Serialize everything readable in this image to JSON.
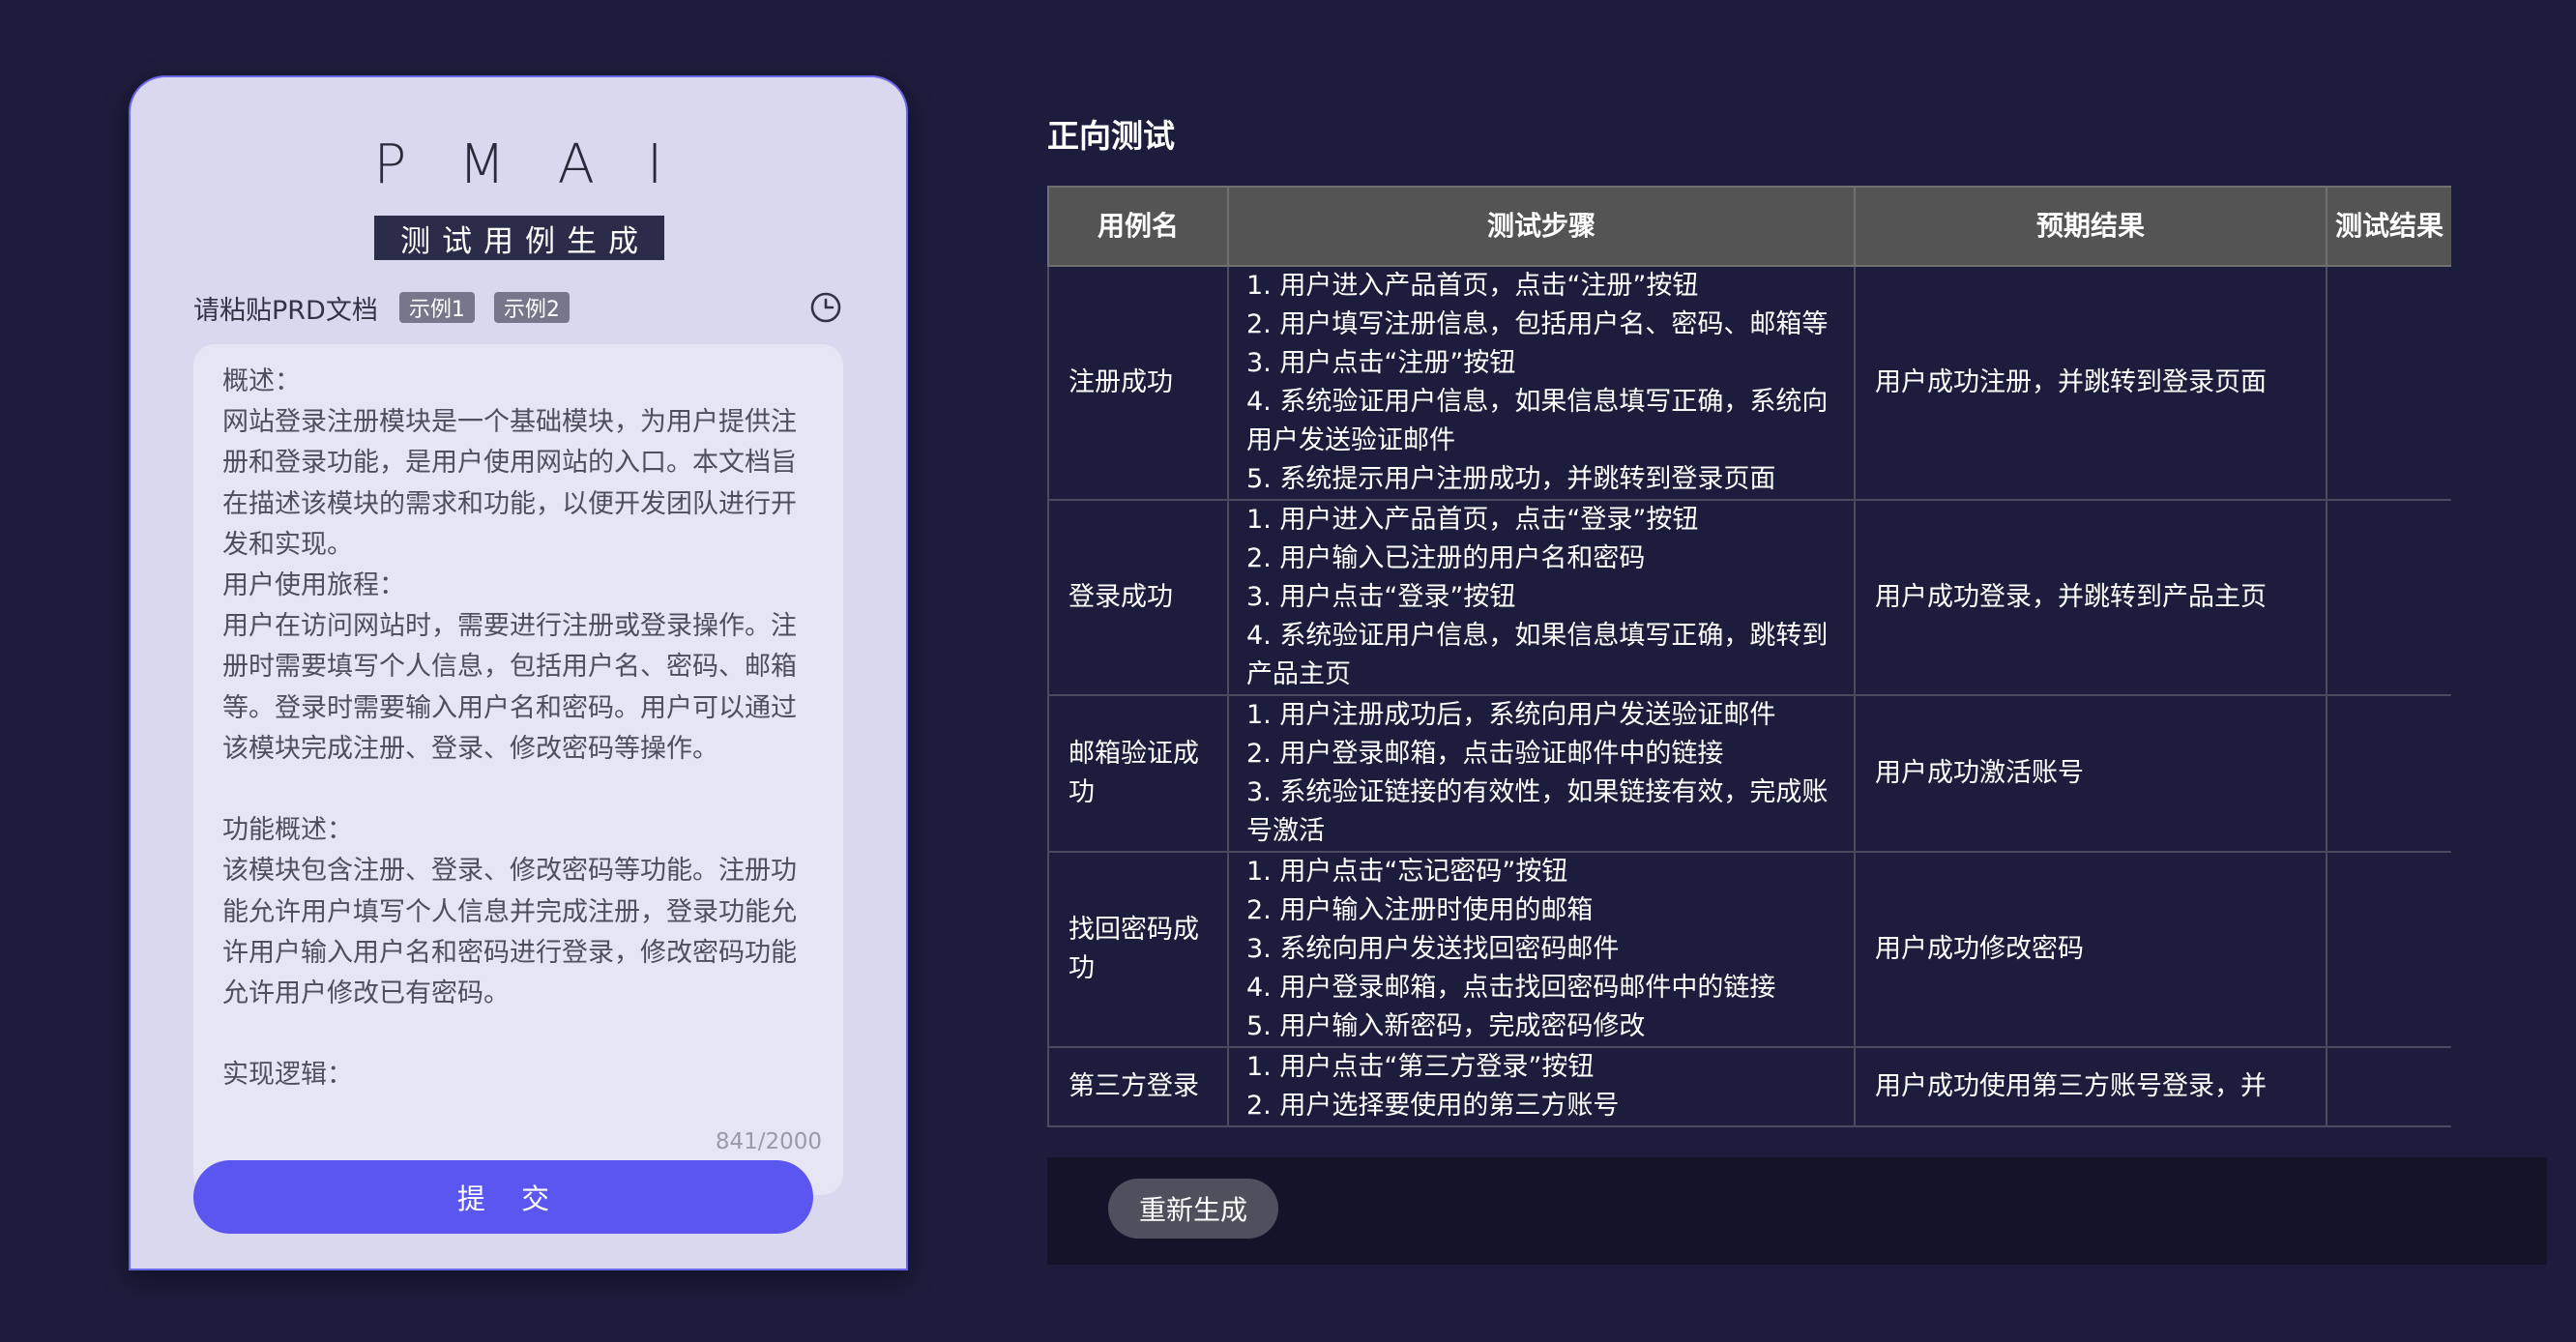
{
  "app": {
    "logo": "PMAI",
    "subtitle": "测试用例生成"
  },
  "prompt": {
    "label": "请粘贴PRD文档",
    "examples": [
      "示例1",
      "示例2"
    ],
    "history_icon": "clock-icon",
    "text": "概述：\n网站登录注册模块是一个基础模块，为用户提供注册和登录功能，是用户使用网站的入口。本文档旨在描述该模块的需求和功能，以便开发团队进行开发和实现。\n用户使用旅程：\n用户在访问网站时，需要进行注册或登录操作。注册时需要填写个人信息，包括用户名、密码、邮箱等。登录时需要输入用户名和密码。用户可以通过该模块完成注册、登录、修改密码等操作。\n\n功能概述：\n该模块包含注册、登录、修改密码等功能。注册功能允许用户填写个人信息并完成注册，登录功能允许用户输入用户名和密码进行登录，修改密码功能允许用户修改已有密码。\n\n实现逻辑：",
    "counter": "841/2000",
    "submit_label": "提 交"
  },
  "results": {
    "section_title": "正向测试",
    "columns": [
      "用例名",
      "测试步骤",
      "预期结果",
      "测试结果"
    ],
    "rows": [
      {
        "name": "注册成功",
        "steps": [
          "1. 用户进入产品首页，点击“注册”按钮",
          "2. 用户填写注册信息，包括用户名、密码、邮箱等",
          "3. 用户点击“注册”按钮",
          "4. 系统验证用户信息，如果信息填写正确，系统向用户发送验证邮件",
          "5. 系统提示用户注册成功，并跳转到登录页面"
        ],
        "expected": "用户成功注册，并跳转到登录页面",
        "result": ""
      },
      {
        "name": "登录成功",
        "steps": [
          "1. 用户进入产品首页，点击“登录”按钮",
          "2. 用户输入已注册的用户名和密码",
          "3. 用户点击“登录”按钮",
          "4. 系统验证用户信息，如果信息填写正确，跳转到产品主页"
        ],
        "expected": "用户成功登录，并跳转到产品主页",
        "result": ""
      },
      {
        "name": "邮箱验证成功",
        "steps": [
          "1. 用户注册成功后，系统向用户发送验证邮件",
          "2. 用户登录邮箱，点击验证邮件中的链接",
          "3. 系统验证链接的有效性，如果链接有效，完成账号激活"
        ],
        "expected": "用户成功激活账号",
        "result": ""
      },
      {
        "name": "找回密码成功",
        "steps": [
          "1. 用户点击“忘记密码”按钮",
          "2. 用户输入注册时使用的邮箱",
          "3. 系统向用户发送找回密码邮件",
          "4. 用户登录邮箱，点击找回密码邮件中的链接",
          "5. 用户输入新密码，完成密码修改"
        ],
        "expected": "用户成功修改密码",
        "result": ""
      },
      {
        "name": "第三方登录",
        "steps": [
          "1. 用户点击“第三方登录”按钮",
          "2. 用户选择要使用的第三方账号"
        ],
        "expected": "用户成功使用第三方账号登录，并",
        "result": ""
      }
    ],
    "regenerate_label": "重新生成"
  }
}
